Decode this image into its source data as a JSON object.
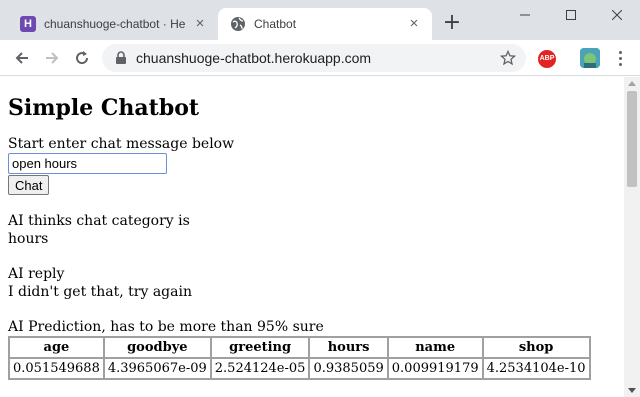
{
  "browser": {
    "tabs": [
      {
        "title": "chuanshuoge-chatbot · Heroku",
        "favicon": "H",
        "active": false
      },
      {
        "title": "Chatbot",
        "active": true
      }
    ],
    "new_tab_symbol": "+",
    "url": "chuanshuoge-chatbot.herokuapp.com",
    "extensions": {
      "abp_label": "ABP"
    }
  },
  "page": {
    "title": "Simple Chatbot",
    "prompt": "Start enter chat message below",
    "input_value": "open hours",
    "chat_button": "Chat",
    "category_label": "AI thinks chat category is",
    "category_value": "hours",
    "reply_label": "AI reply",
    "reply_value": "I didn't get that, try again",
    "prediction_label": "AI Prediction, has to be more than 95% sure",
    "prediction_table": {
      "headers": [
        "age",
        "goodbye",
        "greeting",
        "hours",
        "name",
        "shop"
      ],
      "row": [
        "0.051549688",
        "4.3965067e-09",
        "2.524124e-05",
        "0.9385059",
        "0.009919179",
        "4.2534104e-10"
      ]
    }
  },
  "colors": {
    "tabbar_bg": "#dee1e6",
    "input_focus_border": "#6b8fd8",
    "abp_red": "#e52222"
  }
}
